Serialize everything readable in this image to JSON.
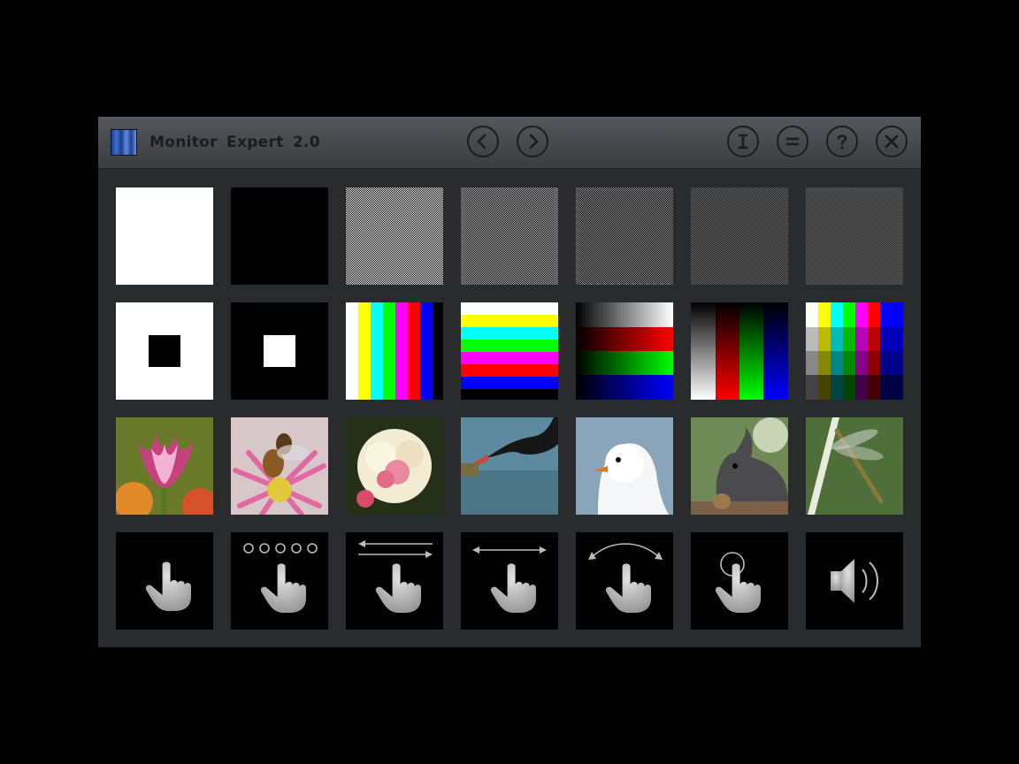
{
  "window": {
    "title": "Monitor  Expert  2.0",
    "icon": "app-logo-icon"
  },
  "toolbar": {
    "buttons": [
      {
        "name": "back-button",
        "icon": "chevron-left-icon"
      },
      {
        "name": "forward-button",
        "icon": "chevron-right-icon"
      },
      {
        "name": "info-button",
        "icon": "info-icon"
      },
      {
        "name": "menu-button",
        "icon": "equals-icon"
      },
      {
        "name": "help-button",
        "icon": "question-icon"
      },
      {
        "name": "close-button",
        "icon": "close-icon"
      }
    ]
  },
  "tests": {
    "rows": [
      [
        "white-screen",
        "black-screen",
        "fine-checker-pattern",
        "medium-checker-pattern",
        "dense-checker-pattern",
        "dark-checker-pattern",
        "darker-checker-pattern"
      ],
      [
        "black-box-on-white",
        "white-box-on-black",
        "vertical-color-bars",
        "horizontal-color-bars",
        "rgb-gradient-rows",
        "rgb-gradient-columns",
        "color-level-matrix"
      ],
      [
        "tulip-photo",
        "bee-on-flower-photo",
        "rose-photo",
        "black-swan-photo",
        "seagull-photo",
        "squirrel-photo",
        "dragonfly-photo"
      ],
      [
        "touch-tap-test",
        "multi-touch-test",
        "swipe-both-ways-test",
        "horizontal-drag-test",
        "arc-gesture-test",
        "circle-touch-test",
        "sound-test"
      ]
    ]
  },
  "colors": {
    "window_bg": "#2a2b2d",
    "titlebar_top": "#54575b",
    "titlebar_bottom": "#3b3d40",
    "bar_colors": [
      "#ffffff",
      "#ffff00",
      "#00ffff",
      "#00ff00",
      "#ff00ff",
      "#ff0000",
      "#0000ff",
      "#000000"
    ]
  }
}
